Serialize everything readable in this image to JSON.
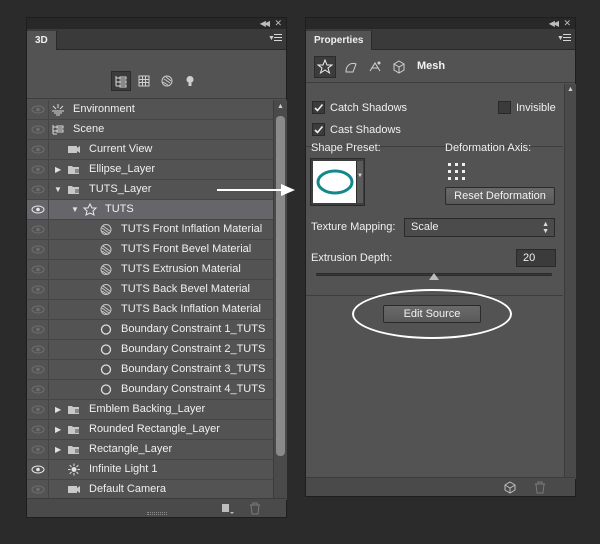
{
  "colors": {
    "panel_bg": "#535353",
    "selection_bg": "#65656a",
    "mesh_preview": "#12888a",
    "annotation": "#ffffff"
  },
  "panel3d": {
    "tab": "3D",
    "filters": [
      {
        "icon": "scene-tree-icon",
        "active": true
      },
      {
        "icon": "mesh-filter-icon",
        "active": false
      },
      {
        "icon": "material-filter-icon",
        "active": false
      },
      {
        "icon": "light-filter-icon",
        "active": false
      }
    ],
    "rows": {
      "r0": {
        "label": "Environment",
        "eye": true,
        "icon": "environment-icon"
      },
      "r1": {
        "label": "Scene",
        "eye": true,
        "icon": "scene-icon"
      },
      "r2": {
        "label": "Current View",
        "eye": true,
        "icon": "camera-icon"
      },
      "r3": {
        "label": "Ellipse_Layer",
        "eye": true,
        "icon": "folder-mesh-icon"
      },
      "r4": {
        "label": "TUTS_Layer",
        "eye": true,
        "icon": "folder-mesh-icon"
      },
      "r5": {
        "label": "TUTS",
        "eye": true,
        "icon": "mesh-icon",
        "selected": true
      },
      "r6": {
        "label": "TUTS Front Inflation Material",
        "eye": true,
        "icon": "material-icon"
      },
      "r7": {
        "label": "TUTS Front Bevel Material",
        "eye": true,
        "icon": "material-icon"
      },
      "r8": {
        "label": "TUTS Extrusion Material",
        "eye": true,
        "icon": "material-icon"
      },
      "r9": {
        "label": "TUTS Back Bevel Material",
        "eye": true,
        "icon": "material-icon"
      },
      "r10": {
        "label": "TUTS Back Inflation Material",
        "eye": true,
        "icon": "material-icon"
      },
      "r11": {
        "label": "Boundary Constraint 1_TUTS",
        "eye": true,
        "icon": "constraint-icon"
      },
      "r12": {
        "label": "Boundary Constraint 2_TUTS",
        "eye": true,
        "icon": "constraint-icon"
      },
      "r13": {
        "label": "Boundary Constraint 3_TUTS",
        "eye": true,
        "icon": "constraint-icon"
      },
      "r14": {
        "label": "Boundary Constraint 4_TUTS",
        "eye": true,
        "icon": "constraint-icon"
      },
      "r15": {
        "label": "Emblem Backing_Layer",
        "eye": true,
        "icon": "folder-mesh-icon"
      },
      "r16": {
        "label": "Rounded Rectangle_Layer",
        "eye": true,
        "icon": "folder-mesh-icon"
      },
      "r17": {
        "label": "Rectangle_Layer",
        "eye": true,
        "icon": "folder-mesh-icon"
      },
      "r18": {
        "label": "Infinite Light 1",
        "eye": true,
        "icon": "light-icon"
      },
      "r19": {
        "label": "Default Camera",
        "eye": true,
        "icon": "camera-icon"
      }
    }
  },
  "properties": {
    "tab": "Properties",
    "toolbar_title": "Mesh",
    "catch_shadows": "Catch Shadows",
    "catch_shadows_checked": true,
    "invisible": "Invisible",
    "invisible_checked": false,
    "cast_shadows": "Cast Shadows",
    "cast_shadows_checked": true,
    "shape_preset_label": "Shape Preset:",
    "deformation_axis_label": "Deformation Axis:",
    "reset_deformation": "Reset Deformation",
    "texture_mapping_label": "Texture Mapping:",
    "texture_mapping_value": "Scale",
    "extrusion_depth_label": "Extrusion Depth:",
    "extrusion_depth_value": "20",
    "extrusion_slider_fraction": 0.5,
    "edit_source": "Edit Source"
  }
}
